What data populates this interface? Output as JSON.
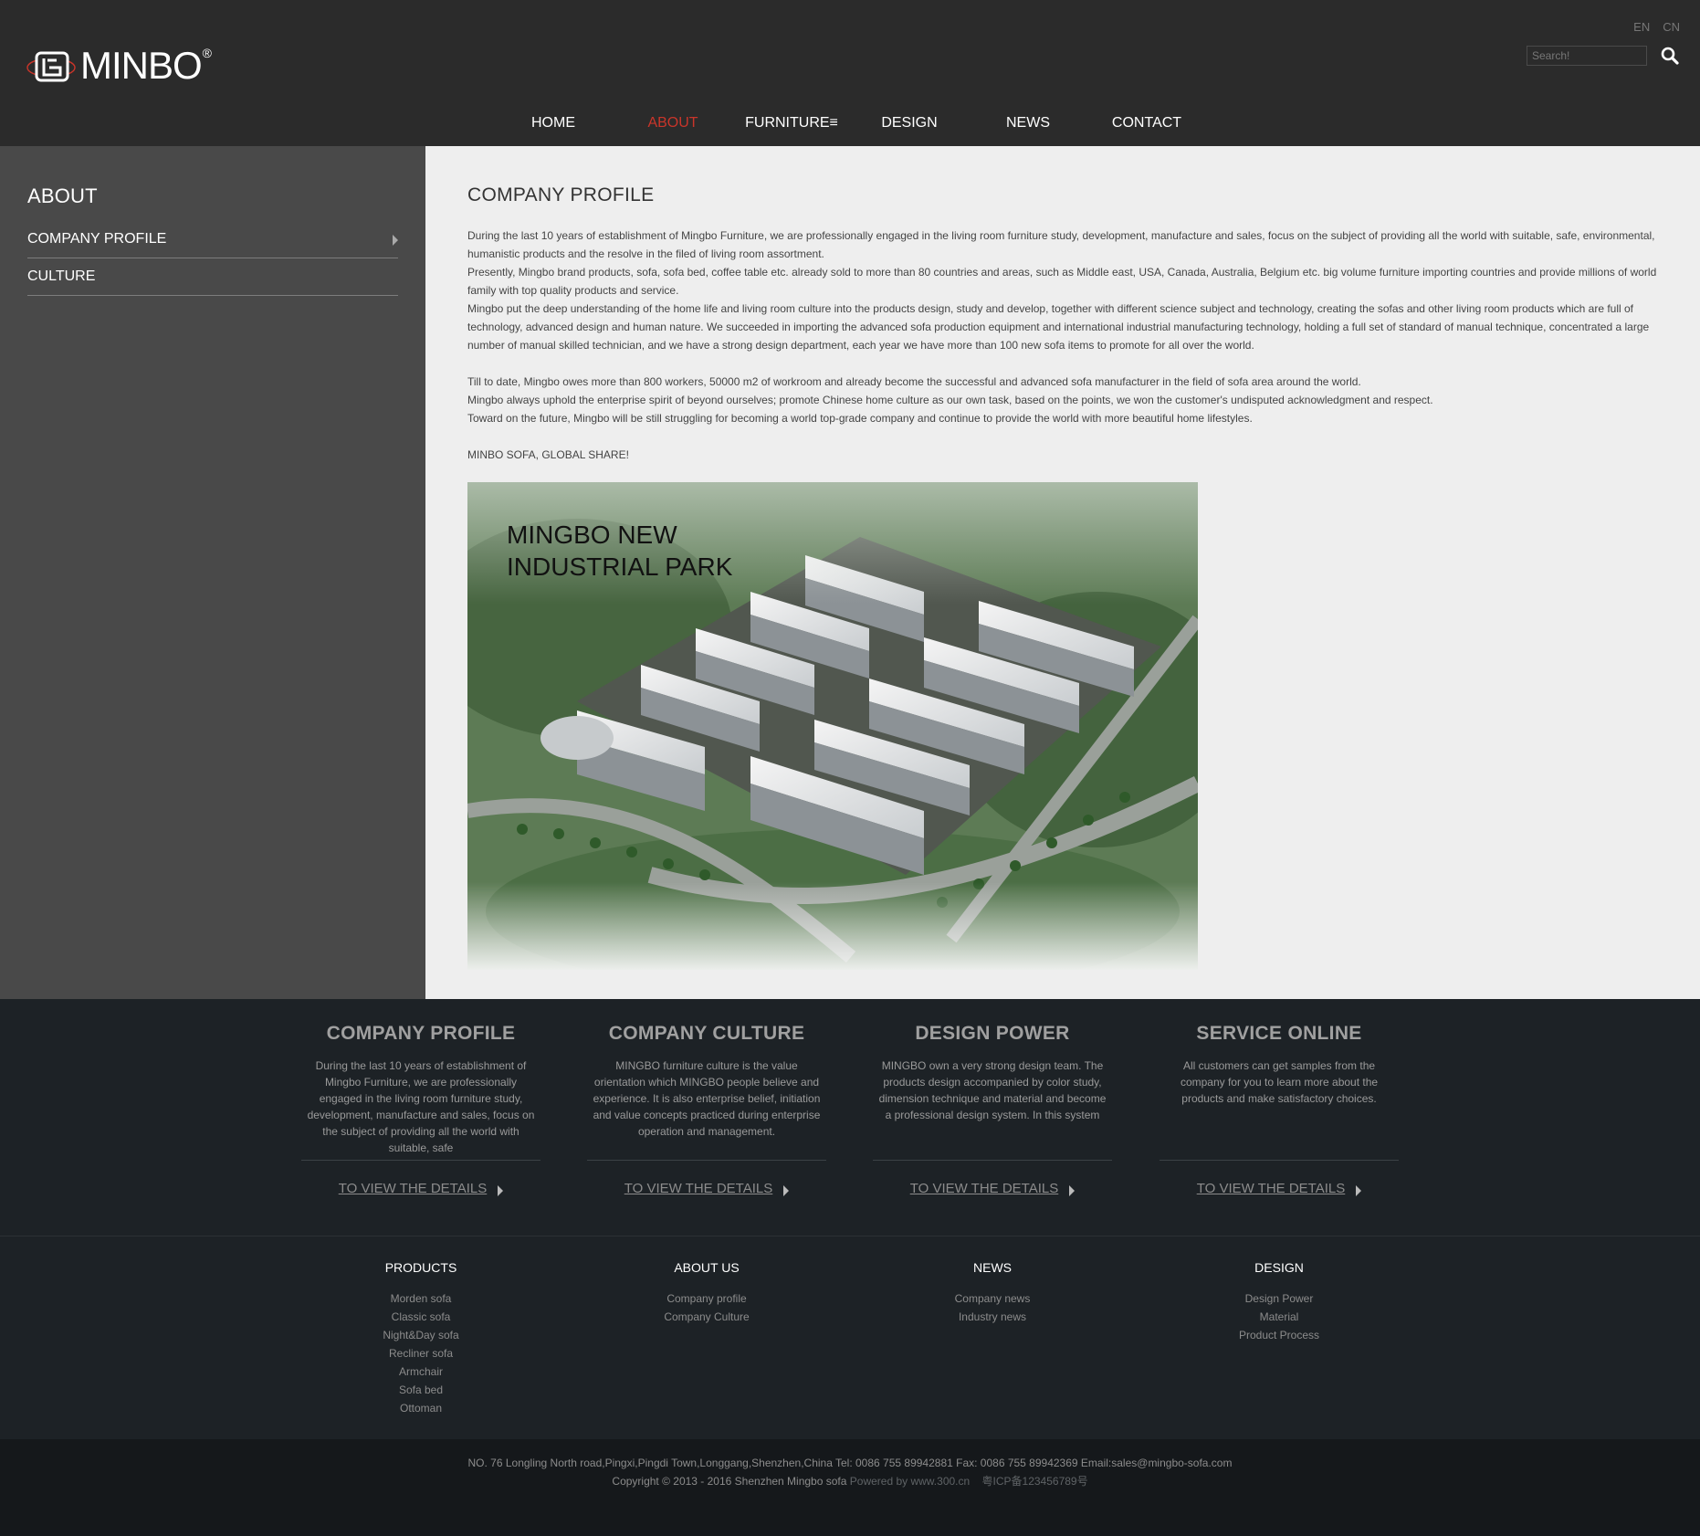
{
  "header": {
    "logo_text": "MINBO",
    "logo_reg": "®",
    "lang": [
      "EN",
      "CN"
    ],
    "search_placeholder": "Search!"
  },
  "nav": [
    {
      "label": "HOME",
      "active": false
    },
    {
      "label": "ABOUT",
      "active": true
    },
    {
      "label": "FURNITURE≡",
      "active": false
    },
    {
      "label": "DESIGN",
      "active": false
    },
    {
      "label": "NEWS",
      "active": false
    },
    {
      "label": "CONTACT",
      "active": false
    }
  ],
  "sidebar": {
    "title": "ABOUT",
    "items": [
      {
        "label": "COMPANY PROFILE"
      },
      {
        "label": "CULTURE"
      }
    ]
  },
  "content": {
    "title": "COMPANY PROFILE",
    "para1": "During the last 10 years of establishment of Mingbo Furniture, we are professionally engaged in the living room furniture study, development, manufacture and sales, focus on the subject of providing all the world with suitable, safe, environmental, humanistic products and the resolve in the filed of living room assortment.",
    "para2": "Presently, Mingbo brand products, sofa, sofa bed, coffee table etc. already sold to more than 80 countries and areas, such as Middle east, USA, Canada, Australia, Belgium etc. big volume furniture importing countries and provide millions of world family with top quality products and service.",
    "para3": "Mingbo put the deep understanding of the home life and living room culture into the products design, study and develop, together with different science subject and technology, creating the sofas and other living room products which are full of technology, advanced design and human nature. We succeeded in importing the advanced sofa production equipment and international industrial manufacturing technology, holding a full set of standard of manual technique, concentrated a large number of manual skilled technician, and we have a strong design department, each year we have more than 100 new sofa items to promote for all over the world.",
    "para4": "Till to date, Mingbo owes more than 800 workers, 50000 m2 of workroom and already become the successful and advanced sofa manufacturer in the field of sofa area around the world.",
    "para5": "Mingbo always uphold the enterprise spirit of beyond ourselves; promote Chinese home culture as our own task, based on the points, we won the customer's undisputed acknowledgment and respect.",
    "para6": "Toward on the future, Mingbo will be still struggling for becoming a world top-grade company and continue to provide the world with more beautiful home lifestyles.",
    "slogan": "MINBO SOFA, GLOBAL SHARE!",
    "image_title_line1": "MINGBO NEW",
    "image_title_line2": "INDUSTRIAL PARK"
  },
  "features": [
    {
      "title": "COMPANY PROFILE",
      "text": "During the last 10 years of establishment of Mingbo Furniture, we are professionally engaged in the living room furniture study, development, manufacture and sales, focus on the subject of providing all the world with suitable, safe",
      "link": "TO VIEW THE DETAILS"
    },
    {
      "title": "COMPANY CULTURE",
      "text": "MINGBO furniture culture is the value orientation which MINGBO people believe and experience. It is also enterprise belief, initiation and value concepts practiced during enterprise operation and management.",
      "link": "TO VIEW THE DETAILS"
    },
    {
      "title": "DESIGN POWER",
      "text": "MINGBO own a very strong design team. The products design accompanied by color study, dimension technique and material and become a professional design system. In this system",
      "link": "TO VIEW THE DETAILS"
    },
    {
      "title": "SERVICE ONLINE",
      "text": "All customers can get samples from the company for you to learn more about the products and make satisfactory choices.",
      "link": "TO VIEW THE DETAILS"
    }
  ],
  "footer_cols": [
    {
      "title": "PRODUCTS",
      "items": [
        "Morden sofa",
        "Classic sofa",
        "Night&Day sofa",
        "Recliner sofa",
        "Armchair",
        "Sofa bed",
        "Ottoman"
      ]
    },
    {
      "title": "ABOUT US",
      "items": [
        "Company profile",
        "Company Culture"
      ]
    },
    {
      "title": "NEWS",
      "items": [
        "Company news",
        "Industry news"
      ]
    },
    {
      "title": "DESIGN",
      "items": [
        "Design Power",
        "Material",
        "Product Process"
      ]
    }
  ],
  "bottom": {
    "address": "NO. 76 Longling North road,Pingxi,Pingdi Town,Longgang,Shenzhen,China Tel: 0086 755 89942881    Fax: 0086 755 89942369    Email:sales@mingbo-sofa.com",
    "copyright": "Copyright © 2013 - 2016 Shenzhen Mingbo sofa",
    "powered": "Powered by www.300.cn",
    "icp": "粤ICP备123456789号"
  },
  "colors": {
    "header_bg": "#2b2b2b",
    "active_nav": "#c9352a",
    "sidebar_bg": "#494949",
    "content_bg": "#eeeeee",
    "footer_bg": "#1d2226"
  }
}
